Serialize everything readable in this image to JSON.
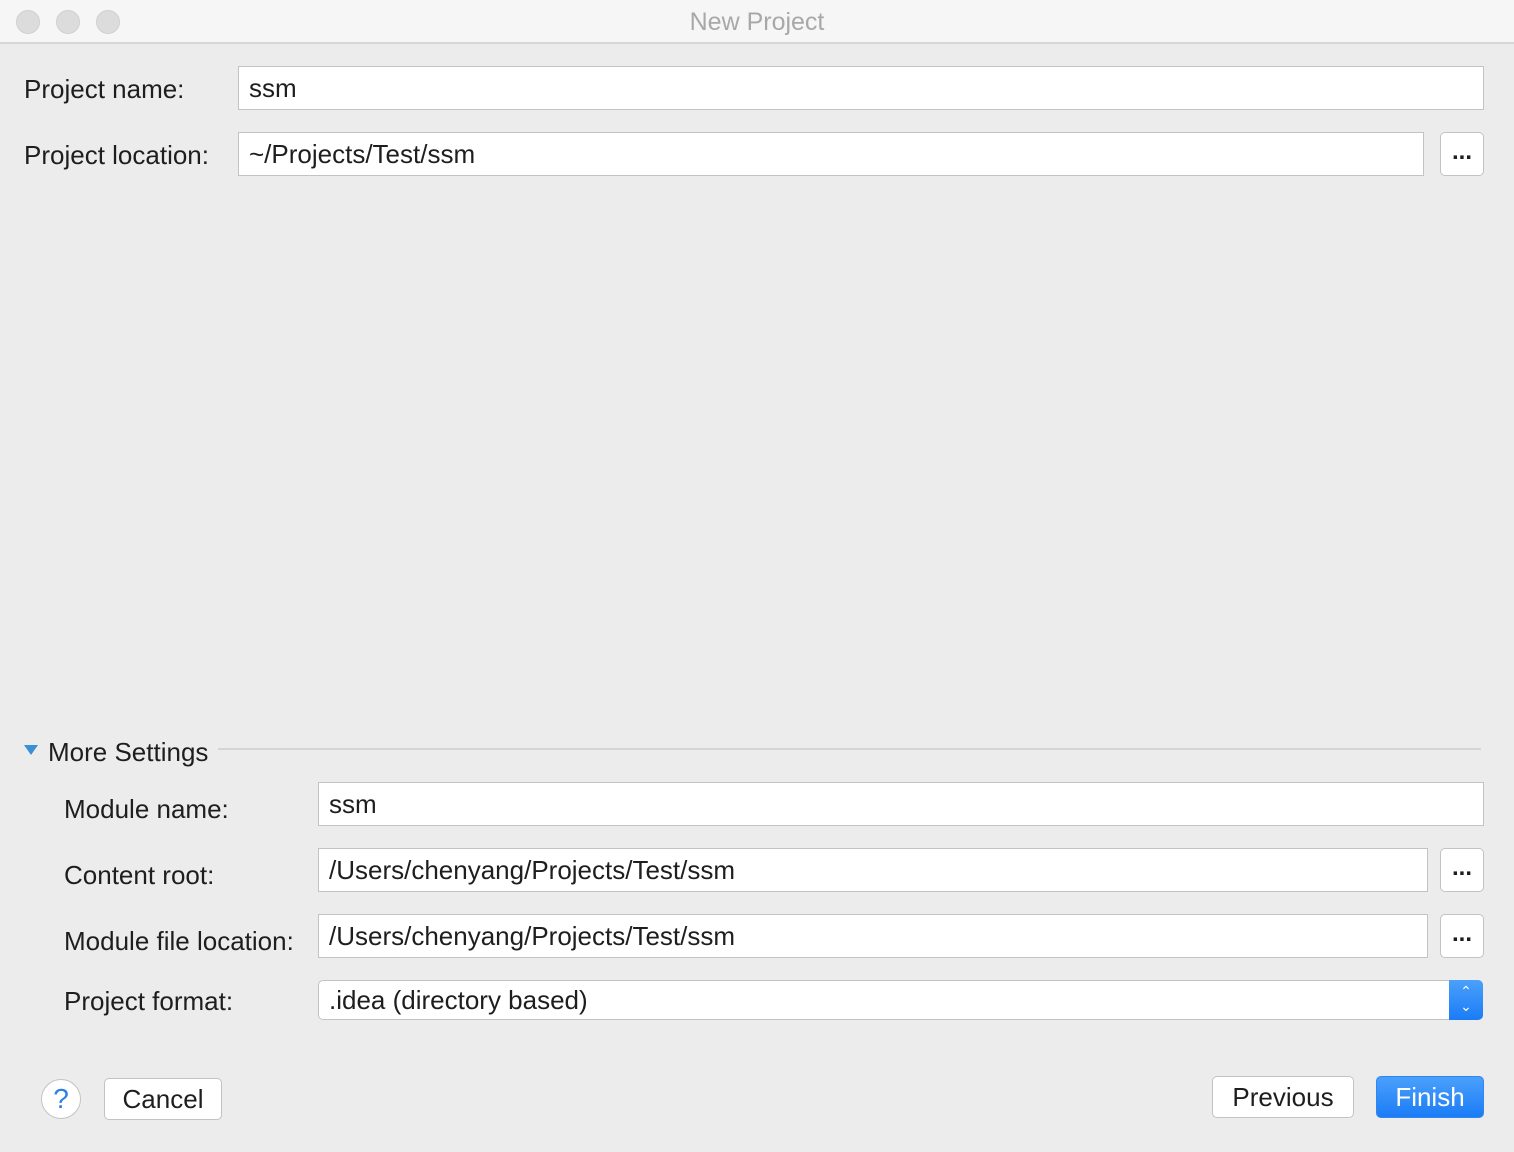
{
  "window": {
    "title": "New Project"
  },
  "project": {
    "name_label": "Project name:",
    "name_value": "ssm",
    "location_label": "Project location:",
    "location_value": "~/Projects/Test/ssm",
    "browse_label": "..."
  },
  "more_settings": {
    "label": "More Settings",
    "expanded": true,
    "module_name_label": "Module name:",
    "module_name_value": "ssm",
    "content_root_label": "Content root:",
    "content_root_value": "/Users/chenyang/Projects/Test/ssm",
    "module_file_label": "Module file location:",
    "module_file_value": "/Users/chenyang/Projects/Test/ssm",
    "format_label": "Project format:",
    "format_value": ".idea (directory based)",
    "browse_label": "..."
  },
  "footer": {
    "help": "?",
    "cancel": "Cancel",
    "previous": "Previous",
    "finish": "Finish"
  },
  "colors": {
    "accent": "#1b7cf6",
    "background": "#ececec"
  }
}
